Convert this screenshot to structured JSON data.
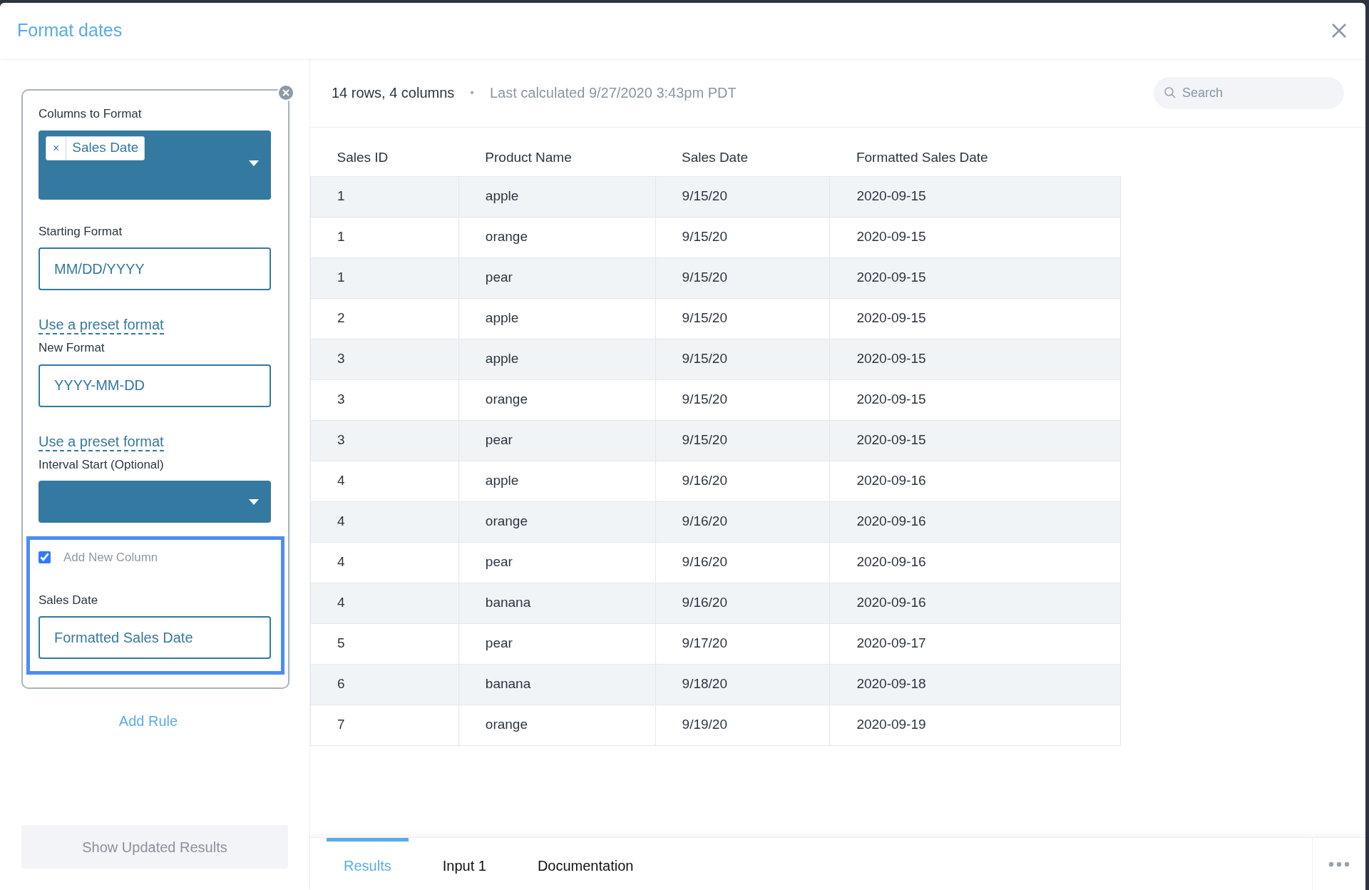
{
  "dialog": {
    "title": "Format dates"
  },
  "rule": {
    "columns_label": "Columns to Format",
    "columns_tags": [
      "Sales Date"
    ],
    "tag_remove": "×",
    "starting_format_label": "Starting Format",
    "starting_format_value": "MM/DD/YYYY",
    "preset_link_1": "Use a preset format",
    "new_format_label": "New Format",
    "new_format_value": "YYYY-MM-DD",
    "preset_link_2": "Use a preset format",
    "interval_label": "Interval Start (Optional)",
    "add_new_column": {
      "label": "Add New Column",
      "checked": true
    },
    "new_column_label": "Sales Date",
    "new_column_value": "Formatted Sales Date"
  },
  "add_rule": "Add Rule",
  "show_results_button": "Show Updated Results",
  "summary": {
    "counts": "14 rows, 4 columns",
    "separator": "•",
    "last_calculated": "Last calculated 9/27/2020 3:43pm PDT"
  },
  "search": {
    "placeholder": "Search"
  },
  "table": {
    "columns": [
      "Sales ID",
      "Product Name",
      "Sales Date",
      "Formatted Sales Date"
    ],
    "rows": [
      [
        "1",
        "apple",
        "9/15/20",
        "2020-09-15"
      ],
      [
        "1",
        "orange",
        "9/15/20",
        "2020-09-15"
      ],
      [
        "1",
        "pear",
        "9/15/20",
        "2020-09-15"
      ],
      [
        "2",
        "apple",
        "9/15/20",
        "2020-09-15"
      ],
      [
        "3",
        "apple",
        "9/15/20",
        "2020-09-15"
      ],
      [
        "3",
        "orange",
        "9/15/20",
        "2020-09-15"
      ],
      [
        "3",
        "pear",
        "9/15/20",
        "2020-09-15"
      ],
      [
        "4",
        "apple",
        "9/16/20",
        "2020-09-16"
      ],
      [
        "4",
        "orange",
        "9/16/20",
        "2020-09-16"
      ],
      [
        "4",
        "pear",
        "9/16/20",
        "2020-09-16"
      ],
      [
        "4",
        "banana",
        "9/16/20",
        "2020-09-16"
      ],
      [
        "5",
        "pear",
        "9/17/20",
        "2020-09-17"
      ],
      [
        "6",
        "banana",
        "9/18/20",
        "2020-09-18"
      ],
      [
        "7",
        "orange",
        "9/19/20",
        "2020-09-19"
      ]
    ]
  },
  "tabs": [
    {
      "label": "Results",
      "selected": true
    },
    {
      "label": "Input 1",
      "selected": false
    },
    {
      "label": "Documentation",
      "selected": false
    }
  ]
}
